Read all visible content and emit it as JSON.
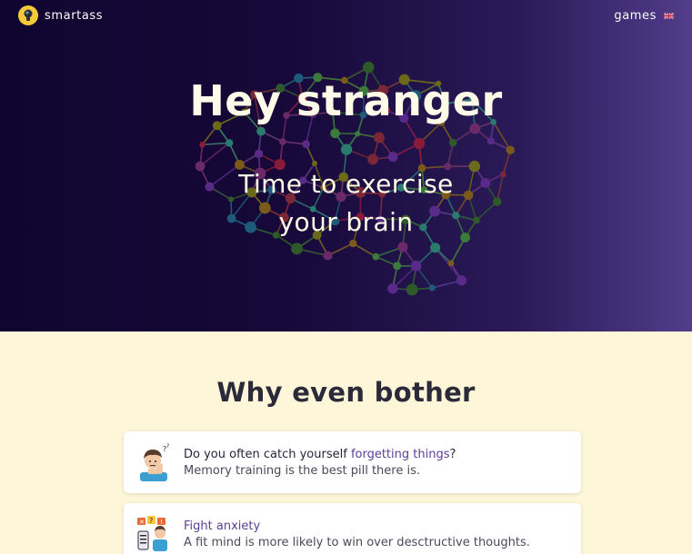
{
  "nav": {
    "logo_text": "smartass",
    "games_label": "games",
    "language_icon": "uk-flag-icon"
  },
  "hero": {
    "title": "Hey stranger",
    "subtitle_line1": "Time to exercise",
    "subtitle_line2": "your brain",
    "background_start": "#100530",
    "background_end": "#523d8a"
  },
  "section": {
    "title": "Why even bother"
  },
  "cards": [
    {
      "icon": "forgetful-person-icon",
      "line1_prefix": "Do you often catch yourself ",
      "line1_highlight": "forgetting things",
      "line1_suffix": "?",
      "line2": "Memory training is the best pill there is."
    },
    {
      "icon": "anxiety-person-icon",
      "line1_highlight": "Fight anxiety",
      "line2": "A fit mind is more likely to win over desctructive thoughts."
    }
  ],
  "colors": {
    "accent": "#5b3f94",
    "page_background": "#fdf6d8",
    "logo_yellow": "#f4c93a"
  }
}
